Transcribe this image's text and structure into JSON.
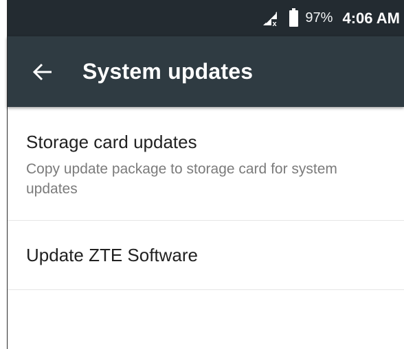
{
  "status_bar": {
    "signal_icon": "no-sim-signal-icon",
    "battery_icon": "battery-icon",
    "battery_percent": "97%",
    "time": "4:06 AM"
  },
  "app_bar": {
    "back_icon": "arrow-back-icon",
    "title": "System updates"
  },
  "list": {
    "items": [
      {
        "title": "Storage card updates",
        "subtitle": "Copy update package to storage card for system updates"
      },
      {
        "title": "Update ZTE Software"
      }
    ]
  },
  "colors": {
    "status_bar_bg": "#232b31",
    "app_bar_bg": "#2f3b42",
    "title_text": "#212121",
    "subtitle_text": "#7b7b7b",
    "divider": "#e6e6e6"
  }
}
